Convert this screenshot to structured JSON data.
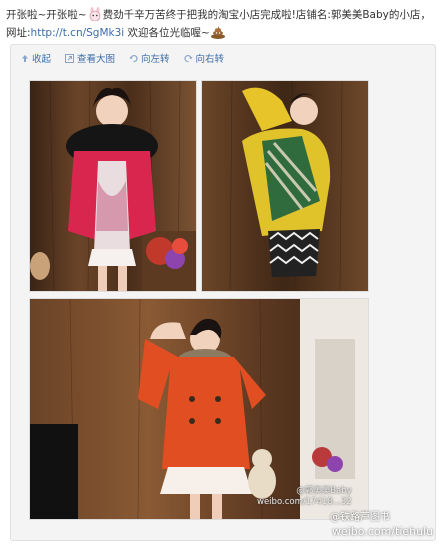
{
  "post": {
    "text_a": "开张啦~开张啦~",
    "text_b": "费劲千辛万苦终于把我的淘宝小店完成啦!店铺名:郭美美Baby的小店，网址:",
    "link": "http://t.cn/SgMk3i",
    "text_c": " 欢迎各位光临喔~",
    "emoticons": [
      "rabbit-emoticon",
      "poop-emoticon"
    ]
  },
  "toolbar": {
    "collapse": "收起",
    "view_large": "查看大图",
    "rotate_left": "向左转",
    "rotate_right": "向右转"
  },
  "photos": [
    {
      "name": "photo-red-coat"
    },
    {
      "name": "photo-green-sweater"
    },
    {
      "name": "photo-orange-coat"
    }
  ],
  "watermarks": {
    "photo_tag": "@郭美美Baby",
    "photo_url": "weibo.com/17418...32",
    "site_tag": "@铁路芦图书",
    "site_url": "weibo.com/tiehulu"
  },
  "colors": {
    "link": "#3b6ca8",
    "background": "#f4f4f4"
  }
}
